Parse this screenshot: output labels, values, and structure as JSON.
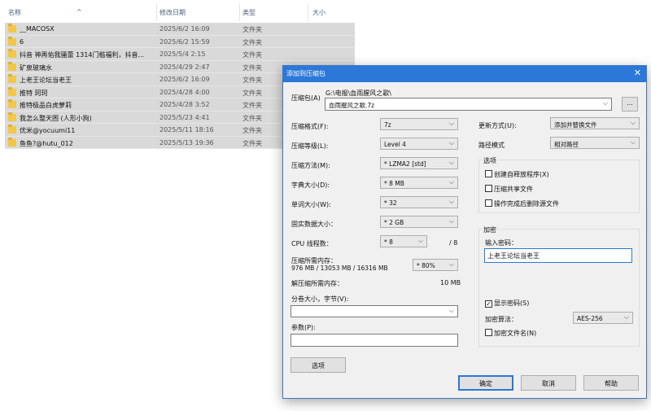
{
  "explorer": {
    "columns": {
      "name": "名称",
      "date": "修改日期",
      "type": "类型",
      "size": "大小"
    },
    "sort_arrow": "^",
    "rows": [
      {
        "name": "__MACOSX",
        "date": "2025/6/2 16:09",
        "type": "文件夹"
      },
      {
        "name": "6",
        "date": "2025/6/2 15:59",
        "type": "文件夹"
      },
      {
        "name": "抖音 神再佑我骚蕾 1314门槛福利，抖音...",
        "date": "2025/5/4 2:15",
        "type": "文件夹"
      },
      {
        "name": "矿泉玻璃水",
        "date": "2025/4/29 2:47",
        "type": "文件夹"
      },
      {
        "name": "上老王论坛当老王",
        "date": "2025/6/2 16:09",
        "type": "文件夹"
      },
      {
        "name": "推特  珂珂",
        "date": "2025/4/28 4:00",
        "type": "文件夹"
      },
      {
        "name": "推特极品白虎萝莉",
        "date": "2025/4/28 3:52",
        "type": "文件夹"
      },
      {
        "name": "我怎么整天困 (人形小狗)",
        "date": "2025/5/23 4:41",
        "type": "文件夹"
      },
      {
        "name": "优米@yocuumi11",
        "date": "2025/5/11 18:16",
        "type": "文件夹"
      },
      {
        "name": "鱼鱼?@hutu_012",
        "date": "2025/5/13 19:36",
        "type": "文件夹"
      }
    ]
  },
  "dialog": {
    "title": "添加到压缩包",
    "close": "✕",
    "archive_label": "压缩包(A)",
    "archive_path": "G:\\电报\\血雨腥风之歌\\",
    "archive_name": "血雨腥风之歌.7z",
    "browse": "...",
    "left": {
      "format_label": "压缩格式(F):",
      "format_value": "7z",
      "level_label": "压缩等级(L):",
      "level_value": "Level 4",
      "method_label": "压缩方法(M):",
      "method_value": "* LZMA2 [std]",
      "dict_label": "字典大小(D):",
      "dict_value": "* 8 MB",
      "word_label": "单词大小(W):",
      "word_value": "* 32",
      "solid_label": "固实数据大小：",
      "solid_value": "* 2 GB",
      "cpu_label": "CPU 线程数：",
      "cpu_value": "* 8",
      "cpu_max": "/ 8",
      "mem_label": "压缩所需内存：",
      "mem_detail": "976 MB / 13053 MB / 16316 MB",
      "mem_percent": "* 80%",
      "decomp_label": "解压缩所需内存：",
      "decomp_value": "10 MB",
      "split_label": "分卷大小，字节(V):",
      "params_label": "参数(P):",
      "options_button": "选项"
    },
    "right": {
      "update_label": "更新方式(U):",
      "update_value": "添加并替换文件",
      "path_label": "路径模式",
      "path_value": "相对路径",
      "options_group": "选项",
      "opt_sfx": "创建自释放程序(X)",
      "opt_shared": "压缩共享文件",
      "opt_delete": "操作完成后删除源文件",
      "encrypt_group": "加密",
      "password_label": "输入密码：",
      "password_value": "上老王论坛当老王",
      "show_password": "显示密码(S)",
      "show_password_check": "✓",
      "algo_label": "加密算法：",
      "algo_value": "AES-256",
      "encrypt_names": "加密文件名(N)"
    },
    "buttons": {
      "ok": "确定",
      "cancel": "取消",
      "help": "帮助"
    }
  }
}
